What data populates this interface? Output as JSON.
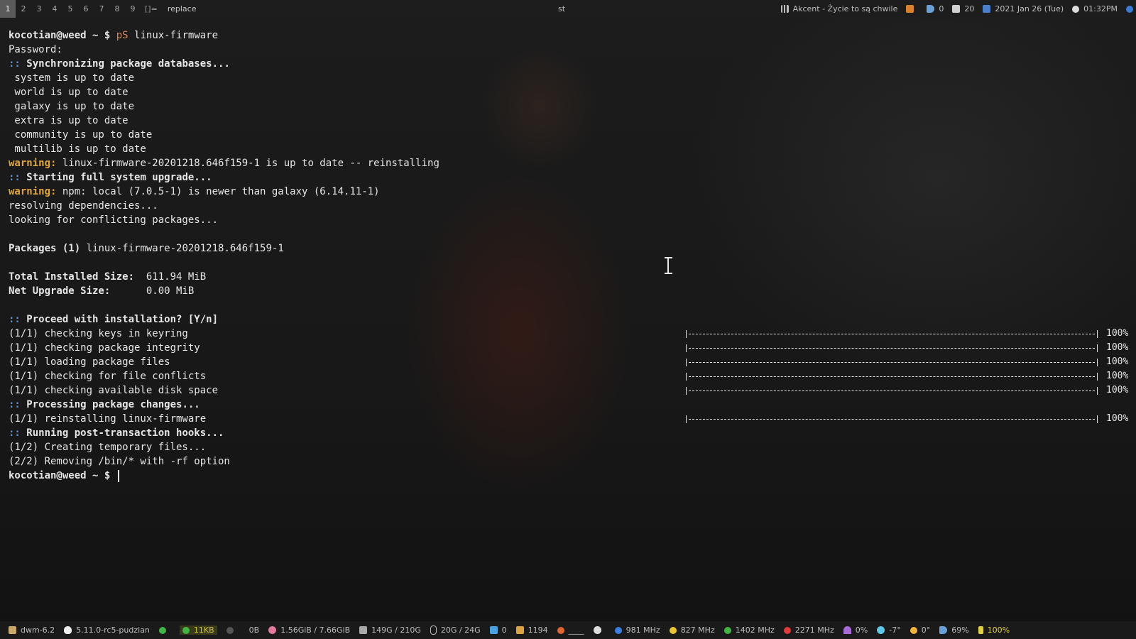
{
  "topbar": {
    "tags": [
      "1",
      "2",
      "3",
      "4",
      "5",
      "6",
      "7",
      "8",
      "9"
    ],
    "active_tag": "1",
    "layout_symbol": "[]=",
    "layout_name": "replace",
    "window_title": "st",
    "music": {
      "icon": "music-icon",
      "text": "Akcent - Życie to są chwile"
    },
    "indicator": {
      "icon": "pause-icon"
    },
    "volume_notify": {
      "icon": "speaker-icon",
      "value": "0"
    },
    "mail": {
      "icon": "mail-icon",
      "value": "20"
    },
    "date": {
      "icon": "calendar-icon",
      "value": "2021 Jan 26 (Tue)"
    },
    "time": {
      "icon": "clock-icon",
      "value": "01:32PM"
    }
  },
  "terminal": {
    "prompt": "kocotian@weed ~ $",
    "command_alias": "pS",
    "command_arg": "linux-firmware",
    "lines": [
      "Password:",
      "Synchronizing package databases...",
      " system is up to date",
      " world is up to date",
      " galaxy is up to date",
      " extra is up to date",
      " community is up to date",
      " multilib is up to date"
    ],
    "warning_label": "warning:",
    "warning1": "linux-firmware-20201218.646f159-1 is up to date -- reinstalling",
    "starting": "Starting full system upgrade...",
    "warning2": "npm: local (7.0.5-1) is newer than galaxy (6.14.11-1)",
    "resolving": "resolving dependencies...",
    "looking": "looking for conflicting packages...",
    "packages_label": "Packages (1)",
    "packages_value": "linux-firmware-20201218.646f159-1",
    "total_label": "Total Installed Size:",
    "total_value": "611.94 MiB",
    "net_label": "Net Upgrade Size:",
    "net_value": "0.00 MiB",
    "proceed": "Proceed with installation? [Y/n]",
    "steps": [
      "(1/1) checking keys in keyring",
      "(1/1) checking package integrity",
      "(1/1) loading package files",
      "(1/1) checking for file conflicts",
      "(1/1) checking available disk space"
    ],
    "processing": "Processing package changes...",
    "reinstalling": "(1/1) reinstalling linux-firmware",
    "hooks": "Running post-transaction hooks...",
    "hook1": "(1/2) Creating temporary files...",
    "hook2": "(2/2) Removing /bin/* with -rf option",
    "final_prompt": "kocotian@weed ~ $",
    "colon_marker": "::"
  },
  "progress": {
    "percent_label": "100%",
    "fraction": 1.0
  },
  "bottombar": {
    "wm": {
      "icon": "window-icon",
      "text": "dwm-6.2"
    },
    "kernel": {
      "icon": "penguin-icon",
      "text": "5.11.0-rc5-pudzian"
    },
    "net_up": {
      "icon": "green-dot-icon"
    },
    "net_down": {
      "icon": "green-dot-icon",
      "text": "11KB"
    },
    "net_other": {
      "icon": "gray-dot-icon",
      "text": "0B"
    },
    "ram": {
      "icon": "brain-icon",
      "text": "1.56GiB / 7.66GiB"
    },
    "disk1": {
      "icon": "monitor-icon",
      "text": "149G / 210G"
    },
    "disk2": {
      "icon": "paperclip-icon",
      "text": "20G / 24G"
    },
    "updates_aur": {
      "icon": "gift-icon",
      "text": "0"
    },
    "packages": {
      "icon": "box-icon",
      "text": "1194"
    },
    "browser": {
      "icon": "firefox-icon",
      "text": "____"
    },
    "cpu_temp": {
      "icon": "cpu-icon"
    },
    "cpu1": {
      "icon": "blue-dot-icon",
      "text": "981 MHz"
    },
    "cpu2": {
      "icon": "yellow-dot-icon",
      "text": "827 MHz"
    },
    "cpu3": {
      "icon": "green-dot-icon",
      "text": "1402 MHz"
    },
    "cpu4": {
      "icon": "red-dot-icon",
      "text": "2271 MHz"
    },
    "rain": {
      "icon": "umbrella-icon",
      "text": "0%"
    },
    "weather": {
      "icon": "cloud-icon",
      "text": "-7°"
    },
    "sun": {
      "icon": "sun-icon",
      "text": "0°"
    },
    "volume": {
      "icon": "speaker-icon",
      "text": "69%"
    },
    "battery": {
      "icon": "bolt-icon",
      "text": "100%"
    }
  },
  "colors": {
    "prompt_alias": "#d48a5b",
    "colon": "#5c8fd6",
    "warning": "#e0a63c",
    "battery": "#e0d23c",
    "net": "#c9c23a"
  }
}
